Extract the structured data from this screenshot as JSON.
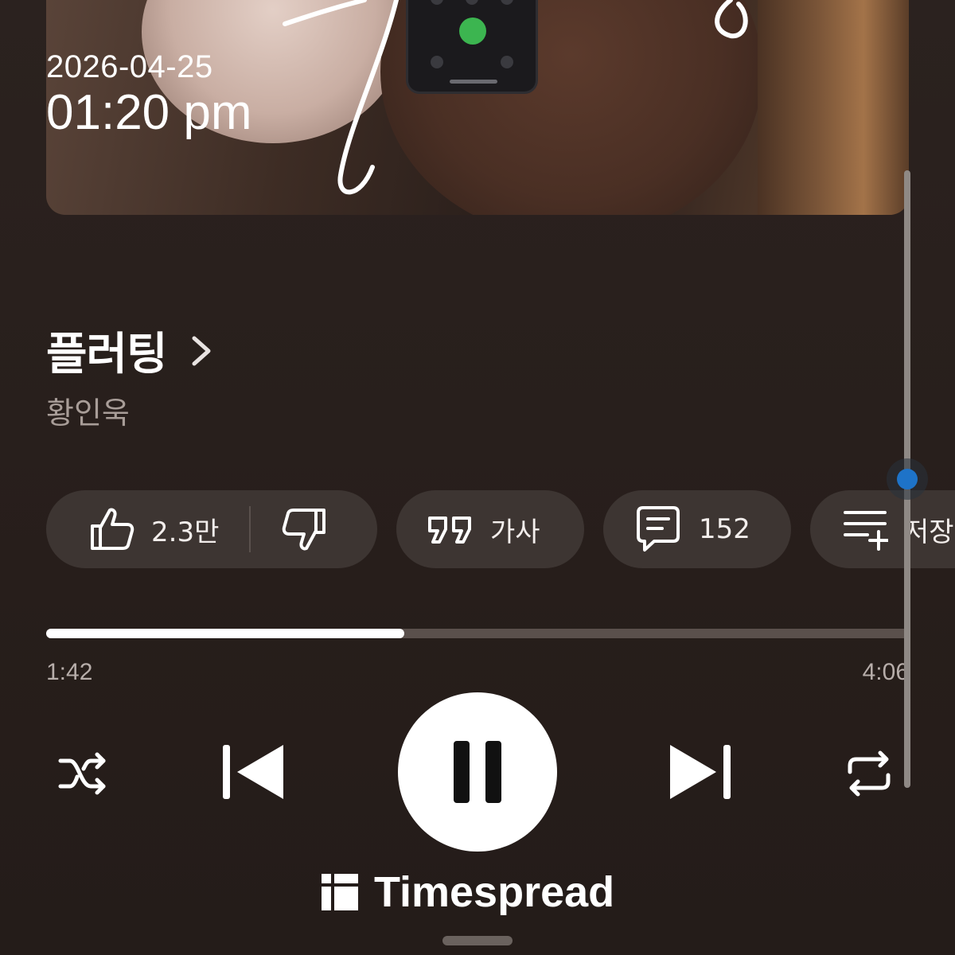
{
  "status": {
    "date": "2026-04-25",
    "time": "01:20 pm"
  },
  "track": {
    "title": "플러팅",
    "artist": "황인욱"
  },
  "actions": {
    "like_count": "2.3만",
    "lyrics_label": "가사",
    "comment_count": "152",
    "save_label": "저장"
  },
  "playback": {
    "current_time": "1:42",
    "duration": "4:06",
    "progress_fraction": 0.415,
    "state": "playing"
  },
  "icons": {
    "like": "thumbs-up-icon",
    "dislike": "thumbs-down-icon",
    "lyrics": "quote-icon",
    "comments": "comment-icon",
    "save": "playlist-add-icon",
    "shuffle": "shuffle-icon",
    "previous": "skip-previous-icon",
    "pause": "pause-icon",
    "next": "skip-next-icon",
    "repeat": "repeat-icon",
    "brand": "timespread-logo-icon"
  },
  "watermark": {
    "brand": "Timespread"
  },
  "colors": {
    "background": "#2a201d",
    "chip": "#3d3532",
    "progress_fill": "#ffffff",
    "progress_track": "#5a504c",
    "scroll_thumb": "#1e73c8"
  }
}
